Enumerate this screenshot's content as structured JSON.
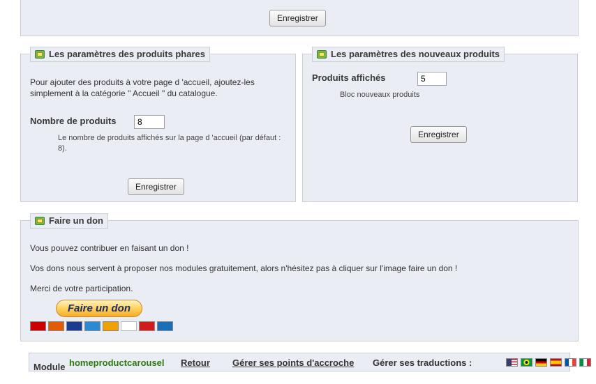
{
  "top_panel": {
    "save_label": "Enregistrer"
  },
  "featured": {
    "legend": "Les paramètres des produits phares",
    "description": "Pour ajouter des produits à votre page d 'accueil, ajoutez-les simplement à la catégorie \" Accueil \" du catalogue.",
    "field_label": "Nombre de produits",
    "field_value": "8",
    "hint": "Le nombre de produits affichés sur la page d 'accueil (par défaut : 8).",
    "save_label": "Enregistrer"
  },
  "new_products": {
    "legend": "Les paramètres des nouveaux produits",
    "field_label": "Produits affichés",
    "field_value": "5",
    "hint": "Bloc nouveaux produits",
    "save_label": "Enregistrer"
  },
  "donate": {
    "legend": "Faire un don",
    "line1": "Vous pouvez contribuer en faisant un don !",
    "line2": "Vos dons nous servent à proposer nos modules gratuitement, alors n'hésitez pas à cliquer sur l'image faire un don !",
    "line3": "Merci de votre participation.",
    "button_label": "Faire un don",
    "cards": [
      {
        "name": "maestro",
        "color": "#cc0000"
      },
      {
        "name": "mastercard",
        "color": "#e35b00"
      },
      {
        "name": "visa",
        "color": "#1a3d8f"
      },
      {
        "name": "amex",
        "color": "#2a8bd3"
      },
      {
        "name": "aurore",
        "color": "#f0a000"
      },
      {
        "name": "cofinoga",
        "color": "#ffffff"
      },
      {
        "name": "4etoiles",
        "color": "#d01c1c"
      },
      {
        "name": "cb",
        "color": "#1b6fb8"
      }
    ]
  },
  "footer": {
    "module_prefix": "Module",
    "module_name": "homeproductcarousel",
    "back_link": "Retour",
    "hooks_link": "Gérer ses points d'accroche",
    "translations_label": "Gérer ses traductions :",
    "flags": [
      {
        "name": "english-flag-icon",
        "colors": [
          "#b22234",
          "#ffffff",
          "#3c3b6e"
        ]
      },
      {
        "name": "brazil-flag-icon",
        "colors": [
          "#009c3b",
          "#ffdf00",
          "#002776"
        ]
      },
      {
        "name": "german-flag-icon",
        "colors": [
          "#000000",
          "#dd0000",
          "#ffce00"
        ]
      },
      {
        "name": "spanish-flag-icon",
        "colors": [
          "#c60b1e",
          "#ffc400",
          "#c60b1e"
        ]
      },
      {
        "name": "french-flag-icon",
        "colors": [
          "#0055a4",
          "#ffffff",
          "#ef4135"
        ]
      },
      {
        "name": "italian-flag-icon",
        "colors": [
          "#009246",
          "#ffffff",
          "#ce2b37"
        ]
      }
    ]
  }
}
